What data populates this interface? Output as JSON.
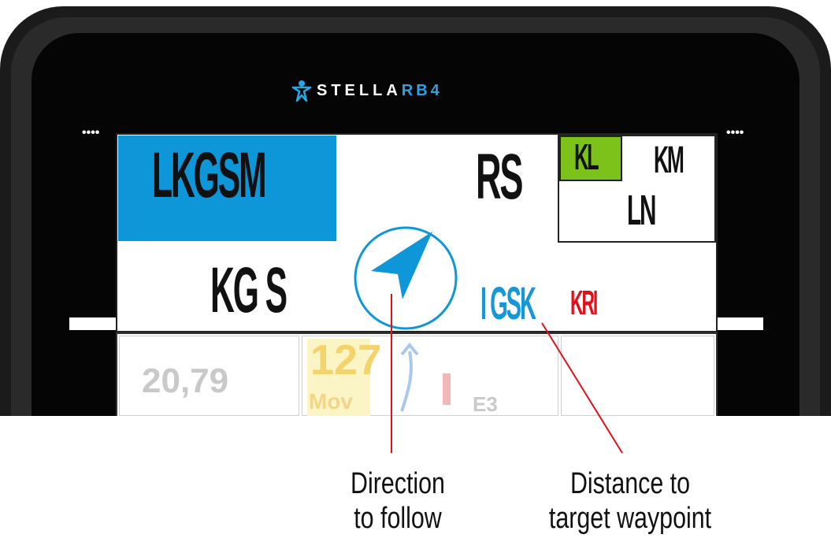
{
  "device": {
    "brand_prefix": "STELLA",
    "brand_suffix": "RB4",
    "left_dots": "••••",
    "right_dots": "••••"
  },
  "display": {
    "top_left": "LKGSM",
    "top_right": "RS",
    "middle_left": "KG S",
    "distance": "I GSK",
    "distance_unit": "KRI",
    "badge": "KL",
    "box_top_right": "KM",
    "box_bottom": "LN"
  },
  "lower_panel": {
    "value_1": "20,79",
    "value_2": "127",
    "value_2_label": "Mov",
    "value_3": "E3"
  },
  "annotations": {
    "direction_line1": "Direction",
    "direction_line2": "to follow",
    "distance_line1": "Distance to",
    "distance_line2": "target waypoint"
  },
  "colors": {
    "accent_blue": "#0d96d8",
    "green_badge": "#7cc21a",
    "red_unit": "#e1111a"
  },
  "icons": [
    "stella-logo-icon",
    "navigation-arrow-icon"
  ]
}
